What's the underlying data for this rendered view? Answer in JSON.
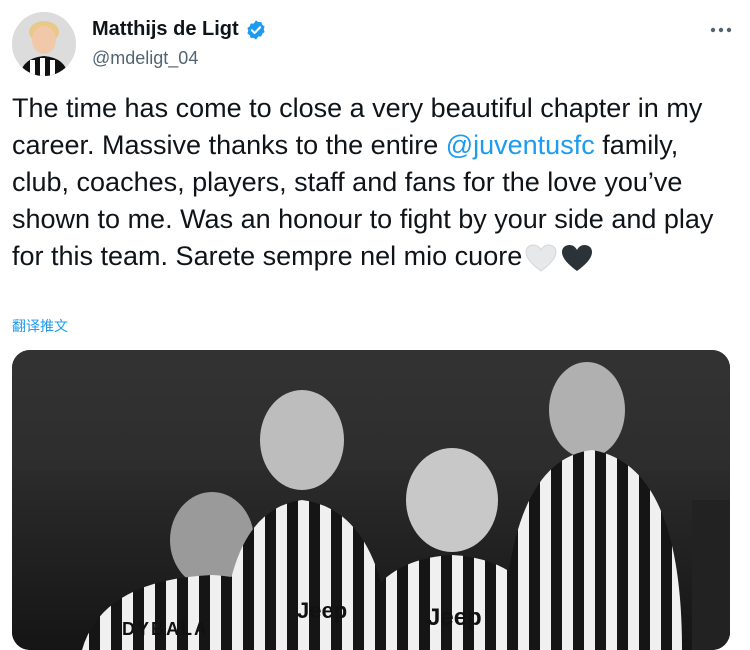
{
  "user": {
    "display_name": "Matthijs de Ligt",
    "handle": "@mdeligt_04"
  },
  "tweet": {
    "text_before": "The time has come to close a very beautiful chapter in my career. Massive thanks to the entire ",
    "mention": "@juventusfc",
    "text_after": " family, club, coaches, players, staff and fans for the love you’ve shown to me. Was an honour to fight by your side and play for this team. Sarete sempre nel mio cuore",
    "translate_label": "翻译推文"
  },
  "media": {
    "jersey_text_1": "DYBALA",
    "jersey_text_2": "Jeep",
    "jersey_text_3": "Jeep"
  },
  "colors": {
    "accent": "#1d9bf0",
    "text": "#0f1419",
    "secondary": "#536471"
  },
  "icons": {
    "verified": "verified-badge-icon",
    "more": "more-horizontal-icon",
    "white_heart": "white-heart-icon",
    "black_heart": "black-heart-icon"
  }
}
